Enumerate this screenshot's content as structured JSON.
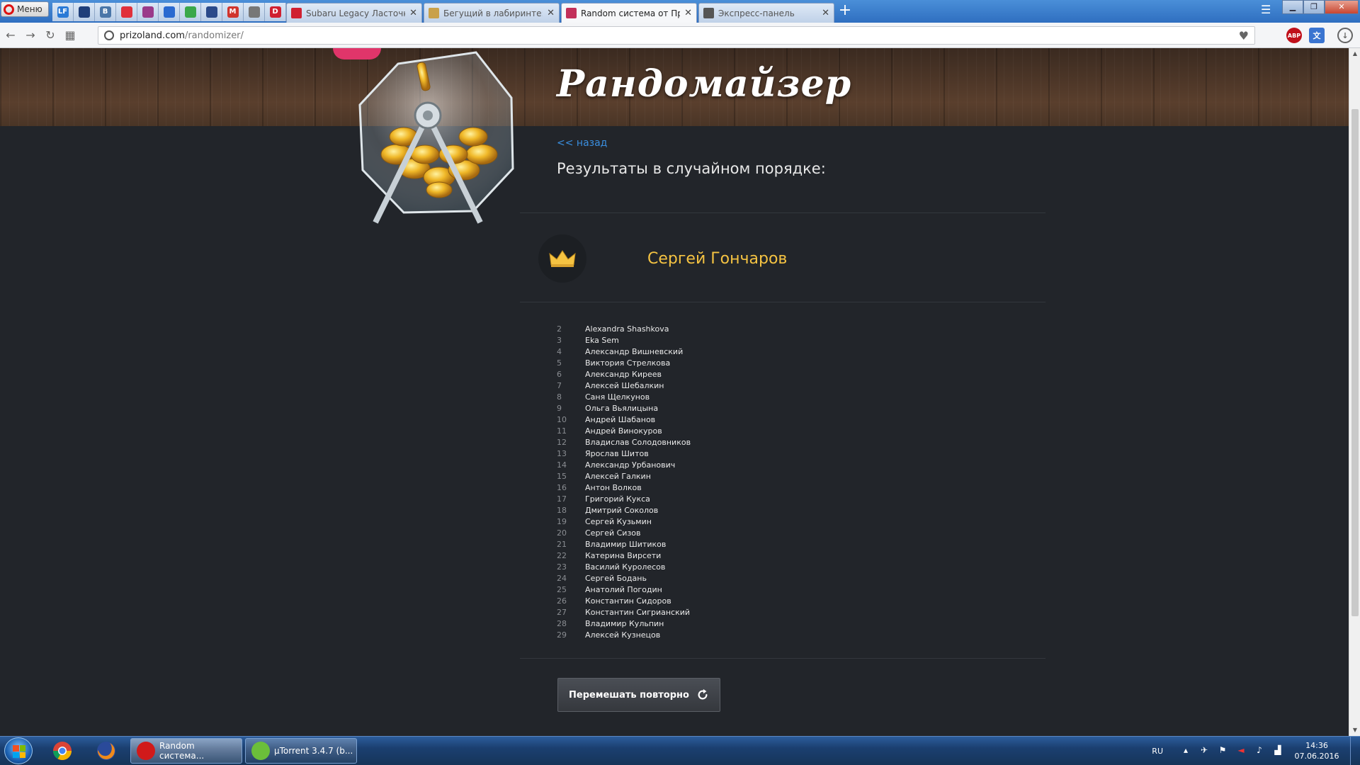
{
  "browser": {
    "menu_label": "Меню",
    "pinned_tabs": [
      {
        "icon": "lf-icon",
        "label": "LF",
        "color": "#2a7ad6"
      },
      {
        "icon": "globe-icon",
        "label": "",
        "color": "#1f3f7a"
      },
      {
        "icon": "vk-icon",
        "label": "В",
        "color": "#4a76a8"
      },
      {
        "icon": "lifebuoy-icon",
        "label": "",
        "color": "#e0303a"
      },
      {
        "icon": "tv-icon",
        "label": "",
        "color": "#9a3a8a"
      },
      {
        "icon": "mail-icon",
        "label": "",
        "color": "#2a6ad0"
      },
      {
        "icon": "green-circle-icon",
        "label": "",
        "color": "#3aa84a"
      },
      {
        "icon": "edit-icon",
        "label": "",
        "color": "#2a4a8a"
      },
      {
        "icon": "gmail-icon",
        "label": "M",
        "color": "#d0342c"
      },
      {
        "icon": "document-icon",
        "label": "",
        "color": "#777777"
      },
      {
        "icon": "d-icon",
        "label": "D",
        "color": "#d02030"
      }
    ],
    "tabs": [
      {
        "title": "Subaru Legacy Ласточка",
        "icon_color": "#d02030",
        "active": false
      },
      {
        "title": "Бегущий в лабиринте: Ис",
        "icon_color": "#c9a14a",
        "active": false
      },
      {
        "title": "Random система от Приз",
        "icon_color": "#c2305a",
        "active": true
      },
      {
        "title": "Экспресс-панель",
        "icon_color": "#555555",
        "active": false
      }
    ],
    "url_host": "prizoland.com",
    "url_path": "/randomizer/",
    "ext_abp": "ABP",
    "ext_translate": "文"
  },
  "page": {
    "title": "Рандомайзер",
    "back_link": "<< назад",
    "results_heading": "Результаты в случайном порядке:",
    "winner": "Сергей Гончаров",
    "accent_color": "#f5c342",
    "link_color": "#3a8fe0",
    "participants": [
      {
        "num": "2",
        "name": "Alexandra Shashkova"
      },
      {
        "num": "3",
        "name": "Eka Sem"
      },
      {
        "num": "4",
        "name": "Александр Вишневский"
      },
      {
        "num": "5",
        "name": "Виктория Стрелкова"
      },
      {
        "num": "6",
        "name": "Александр Киреев"
      },
      {
        "num": "7",
        "name": "Алексей Шебалкин"
      },
      {
        "num": "8",
        "name": "Саня Щелкунов"
      },
      {
        "num": "9",
        "name": "Ольга Вьялицына"
      },
      {
        "num": "10",
        "name": "Андрей Шабанов"
      },
      {
        "num": "11",
        "name": "Андрей Винокуров"
      },
      {
        "num": "12",
        "name": "Владислав Солодовников"
      },
      {
        "num": "13",
        "name": "Ярослав Шитов"
      },
      {
        "num": "14",
        "name": "Александр Урбанович"
      },
      {
        "num": "15",
        "name": "Алексей Галкин"
      },
      {
        "num": "16",
        "name": "Антон Волков"
      },
      {
        "num": "17",
        "name": "Григорий Кукса"
      },
      {
        "num": "18",
        "name": "Дмитрий Соколов"
      },
      {
        "num": "19",
        "name": "Сергей Кузьмин"
      },
      {
        "num": "20",
        "name": "Сергей Сизов"
      },
      {
        "num": "21",
        "name": "Владимир Шитиков"
      },
      {
        "num": "22",
        "name": "Катерина Вирсети"
      },
      {
        "num": "23",
        "name": "Василий Куролесов"
      },
      {
        "num": "24",
        "name": "Сергей Бодань"
      },
      {
        "num": "25",
        "name": "Анатолий Погодин"
      },
      {
        "num": "26",
        "name": "Константин Сидоров"
      },
      {
        "num": "27",
        "name": "Константин Сигрианский"
      },
      {
        "num": "28",
        "name": "Владимир Кульпин"
      },
      {
        "num": "29",
        "name": "Алексей Кузнецов"
      }
    ],
    "shuffle_button": "Перемешать повторно"
  },
  "taskbar": {
    "apps": [
      {
        "label": "Random система...",
        "icon": "opera-icon",
        "color": "#d11a1a",
        "active": true
      },
      {
        "label": "µTorrent 3.4.7  (b...",
        "icon": "utorrent-icon",
        "color": "#6bbf3a",
        "active": false
      }
    ],
    "language": "RU",
    "time": "14:36",
    "date": "07.06.2016"
  }
}
